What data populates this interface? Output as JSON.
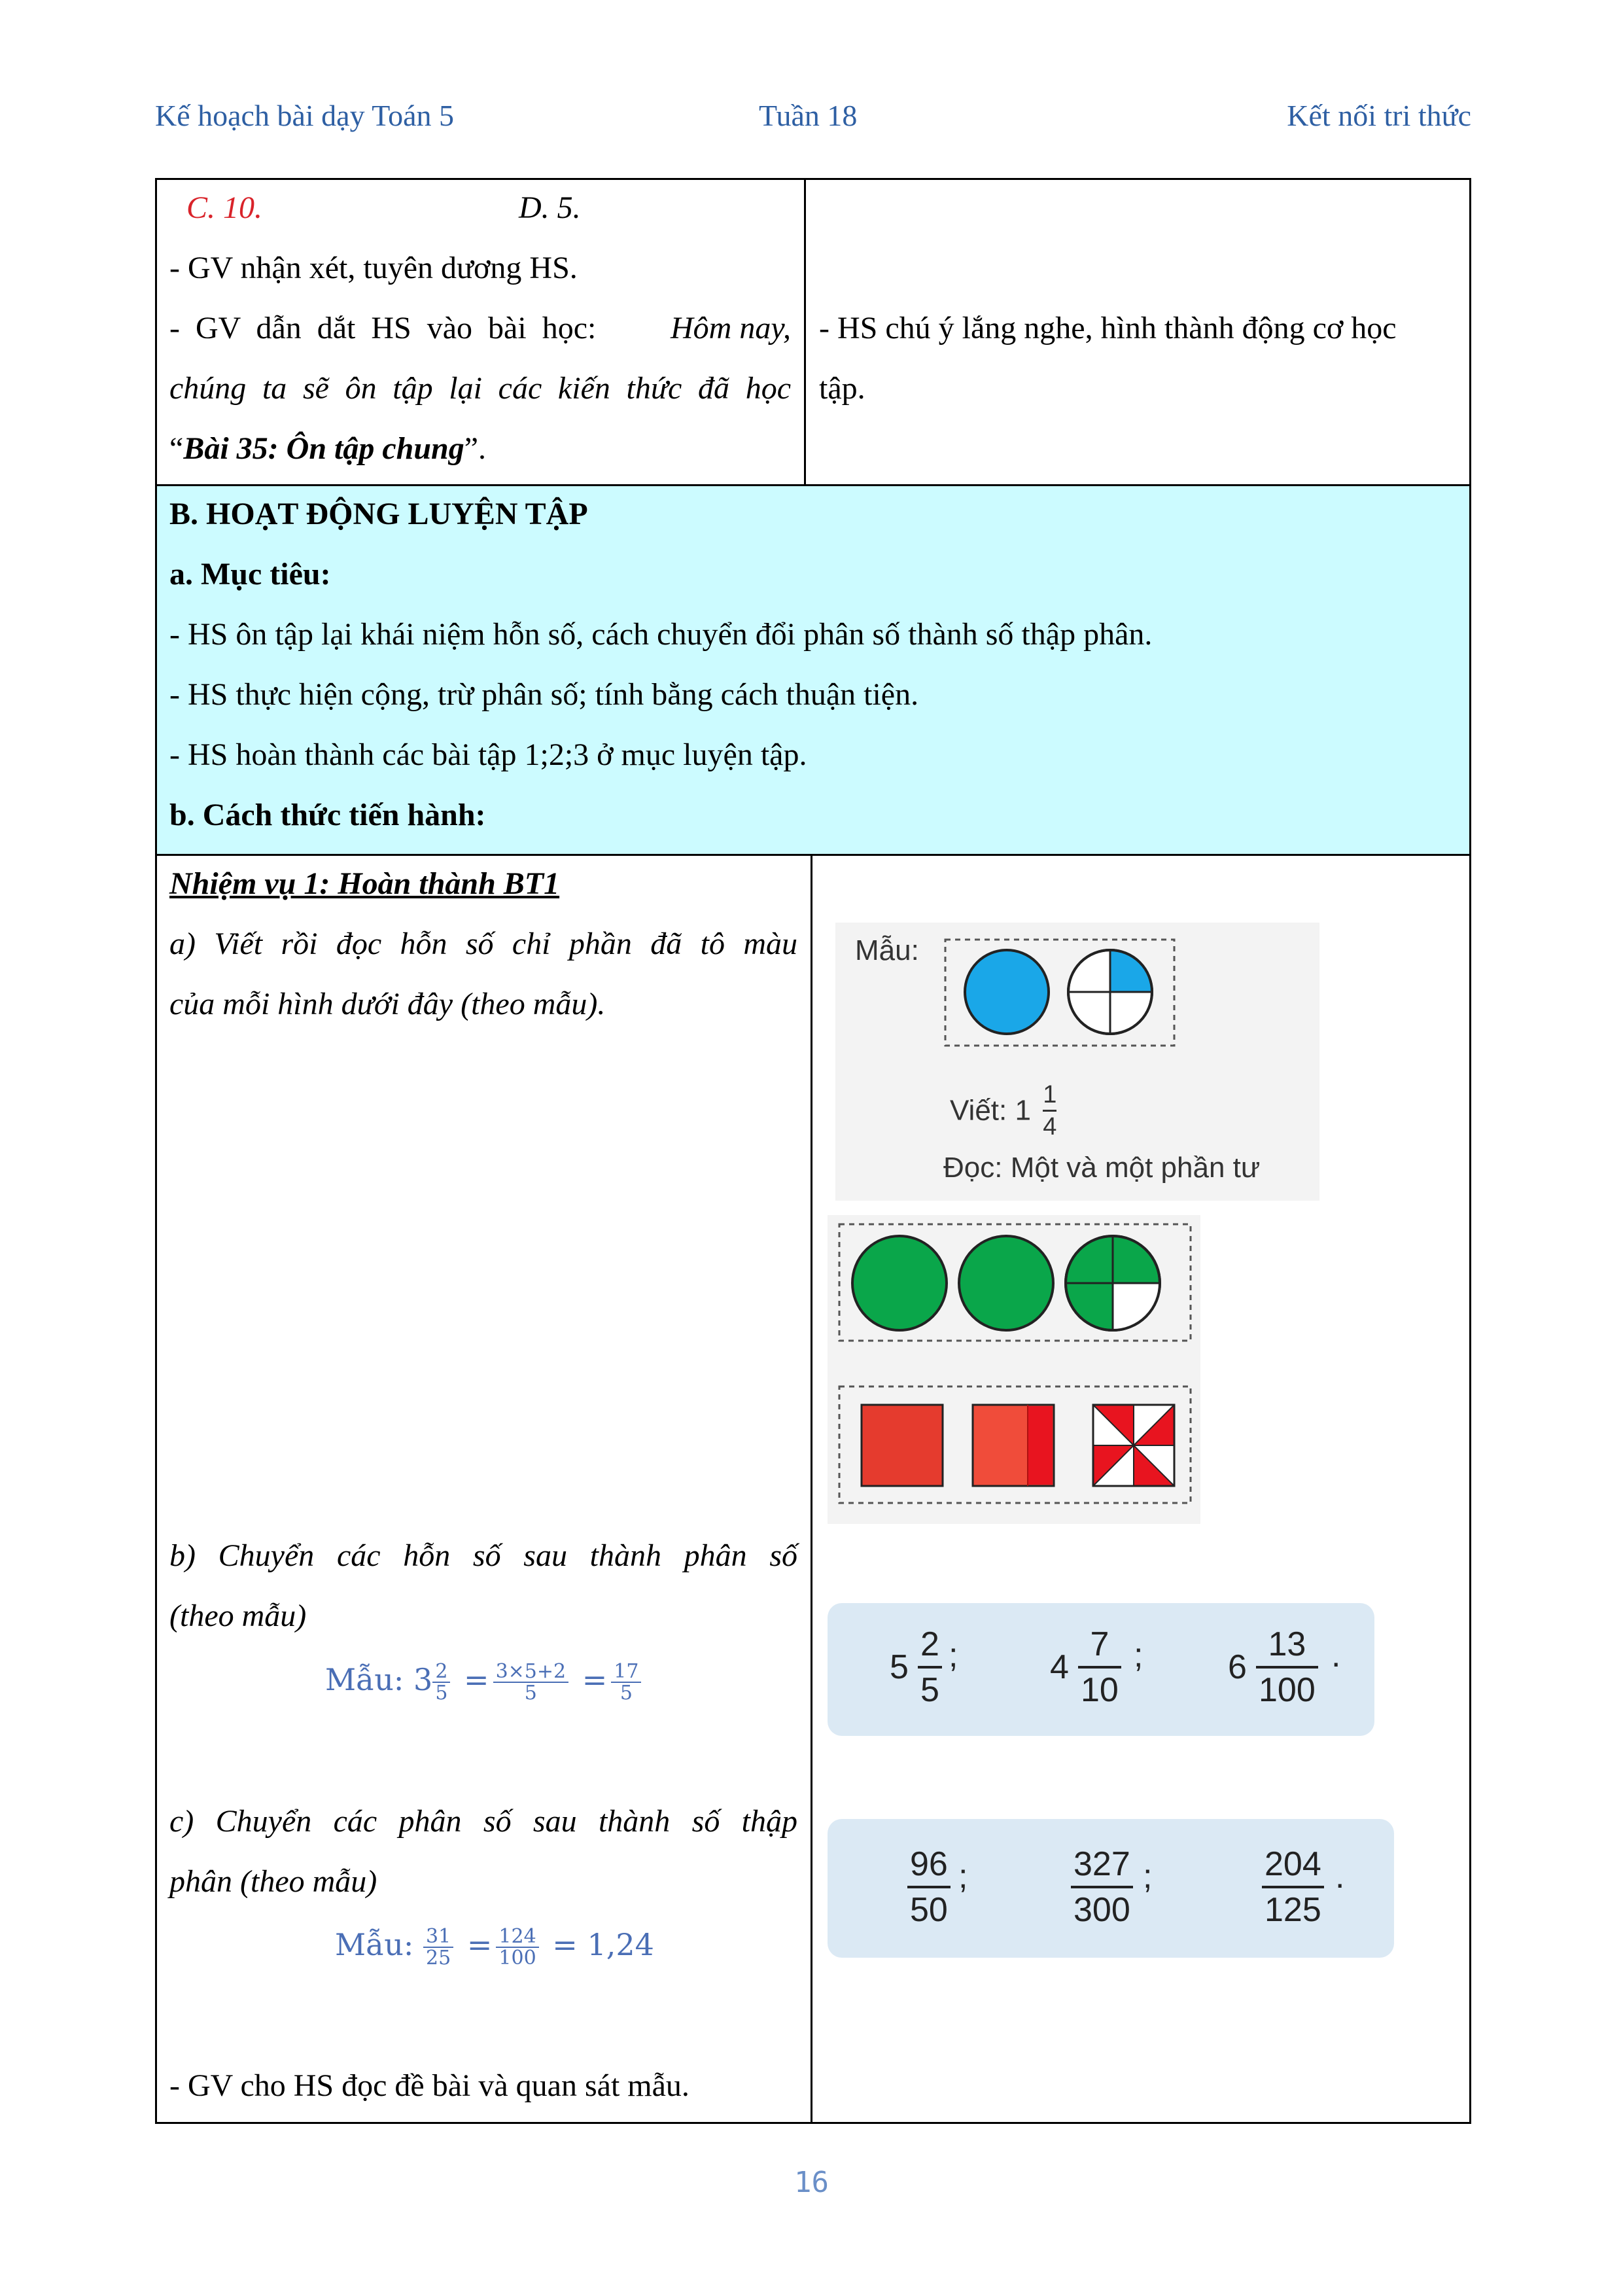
{
  "header": {
    "left": "Kế hoạch bài dạy Toán 5",
    "center": "Tuần 18",
    "right": "Kết nối tri thức"
  },
  "row1": {
    "option_c": "C. 10.",
    "option_d": "D. 5.",
    "line_gv_praise": "- GV nhận xét, tuyên dương HS.",
    "line_gv_intro_prefix": "- GV dẫn dắt HS vào bài học:",
    "line_gv_intro_italic": "Hôm nay,",
    "line_gv_intro_2": "chúng ta sẽ ôn tập lại các kiến thức đã học",
    "lesson_open_quote": "“",
    "lesson_title": "Bài 35: Ôn tập chung",
    "lesson_close_quote": "”.",
    "hs_response_1": "- HS chú ý lắng nghe, hình thành động cơ học",
    "hs_response_2": "tập."
  },
  "section_b": {
    "title": "B. HOẠT ĐỘNG LUYỆN TẬP",
    "objective_heading": "a. Mục tiêu:",
    "objectives": [
      "- HS ôn tập lại khái niệm hỗn số, cách chuyển đổi phân số thành số thập phân.",
      "- HS thực hiện cộng, trừ phân số; tính bằng cách thuận tiện.",
      "- HS hoàn thành các bài tập 1;2;3 ở mục luyện tập."
    ],
    "method_heading": "b. Cách thức tiến hành:"
  },
  "task1": {
    "title": "Nhiệm vụ 1: Hoàn thành BT1",
    "part_a_1": "a) Viết rồi đọc hỗn số chỉ phần đã tô màu",
    "part_a_2": "của mỗi hình dưới đây (theo mẫu).",
    "part_b_1": "b) Chuyển các hỗn số sau thành phân số",
    "part_b_2": "(theo mẫu)",
    "part_b_sample_label": "Mẫu: 3",
    "part_b_sample": {
      "f1n": "2",
      "f1d": "5",
      "eq1": "=",
      "f2n": "3×5+2",
      "f2d": "5",
      "eq2": "=",
      "f3n": "17",
      "f3d": "5"
    },
    "part_c_1": "c) Chuyển các phân số sau thành số thập",
    "part_c_2": "phân (theo mẫu)",
    "part_c_sample_label": "Mẫu:",
    "part_c_sample": {
      "f1n": "31",
      "f1d": "25",
      "eq1": "=",
      "f2n": "124",
      "f2d": "100",
      "result": "= 1,24"
    },
    "gv_read": "- GV cho HS đọc đề bài và quan sát mẫu."
  },
  "figure_sample": {
    "label": "Mẫu:",
    "write_label": "Viết: 1",
    "write_num": "1",
    "write_den": "4",
    "read_label": "Đọc: Một và một phần tư"
  },
  "figure_mixed": [
    {
      "whole": "5",
      "num": "2",
      "den": "5",
      "sep": ";"
    },
    {
      "whole": "4",
      "num": "7",
      "den": "10",
      "sep": ";"
    },
    {
      "whole": "6",
      "num": "13",
      "den": "100",
      "sep": "."
    }
  ],
  "figure_fractions": [
    {
      "num": "96",
      "den": "50",
      "sep": ";"
    },
    {
      "num": "327",
      "den": "300",
      "sep": ";"
    },
    {
      "num": "204",
      "den": "125",
      "sep": "."
    }
  ],
  "colors": {
    "header_blue": "#2e5fa3",
    "section_bg": "#ccfbff",
    "red": "#d9232a",
    "math_blue": "#4a6eb5",
    "circle_blue": "#1aa7e8",
    "circle_green": "#0aa64a",
    "square_red": "#e53b2e"
  },
  "page_number": "16"
}
